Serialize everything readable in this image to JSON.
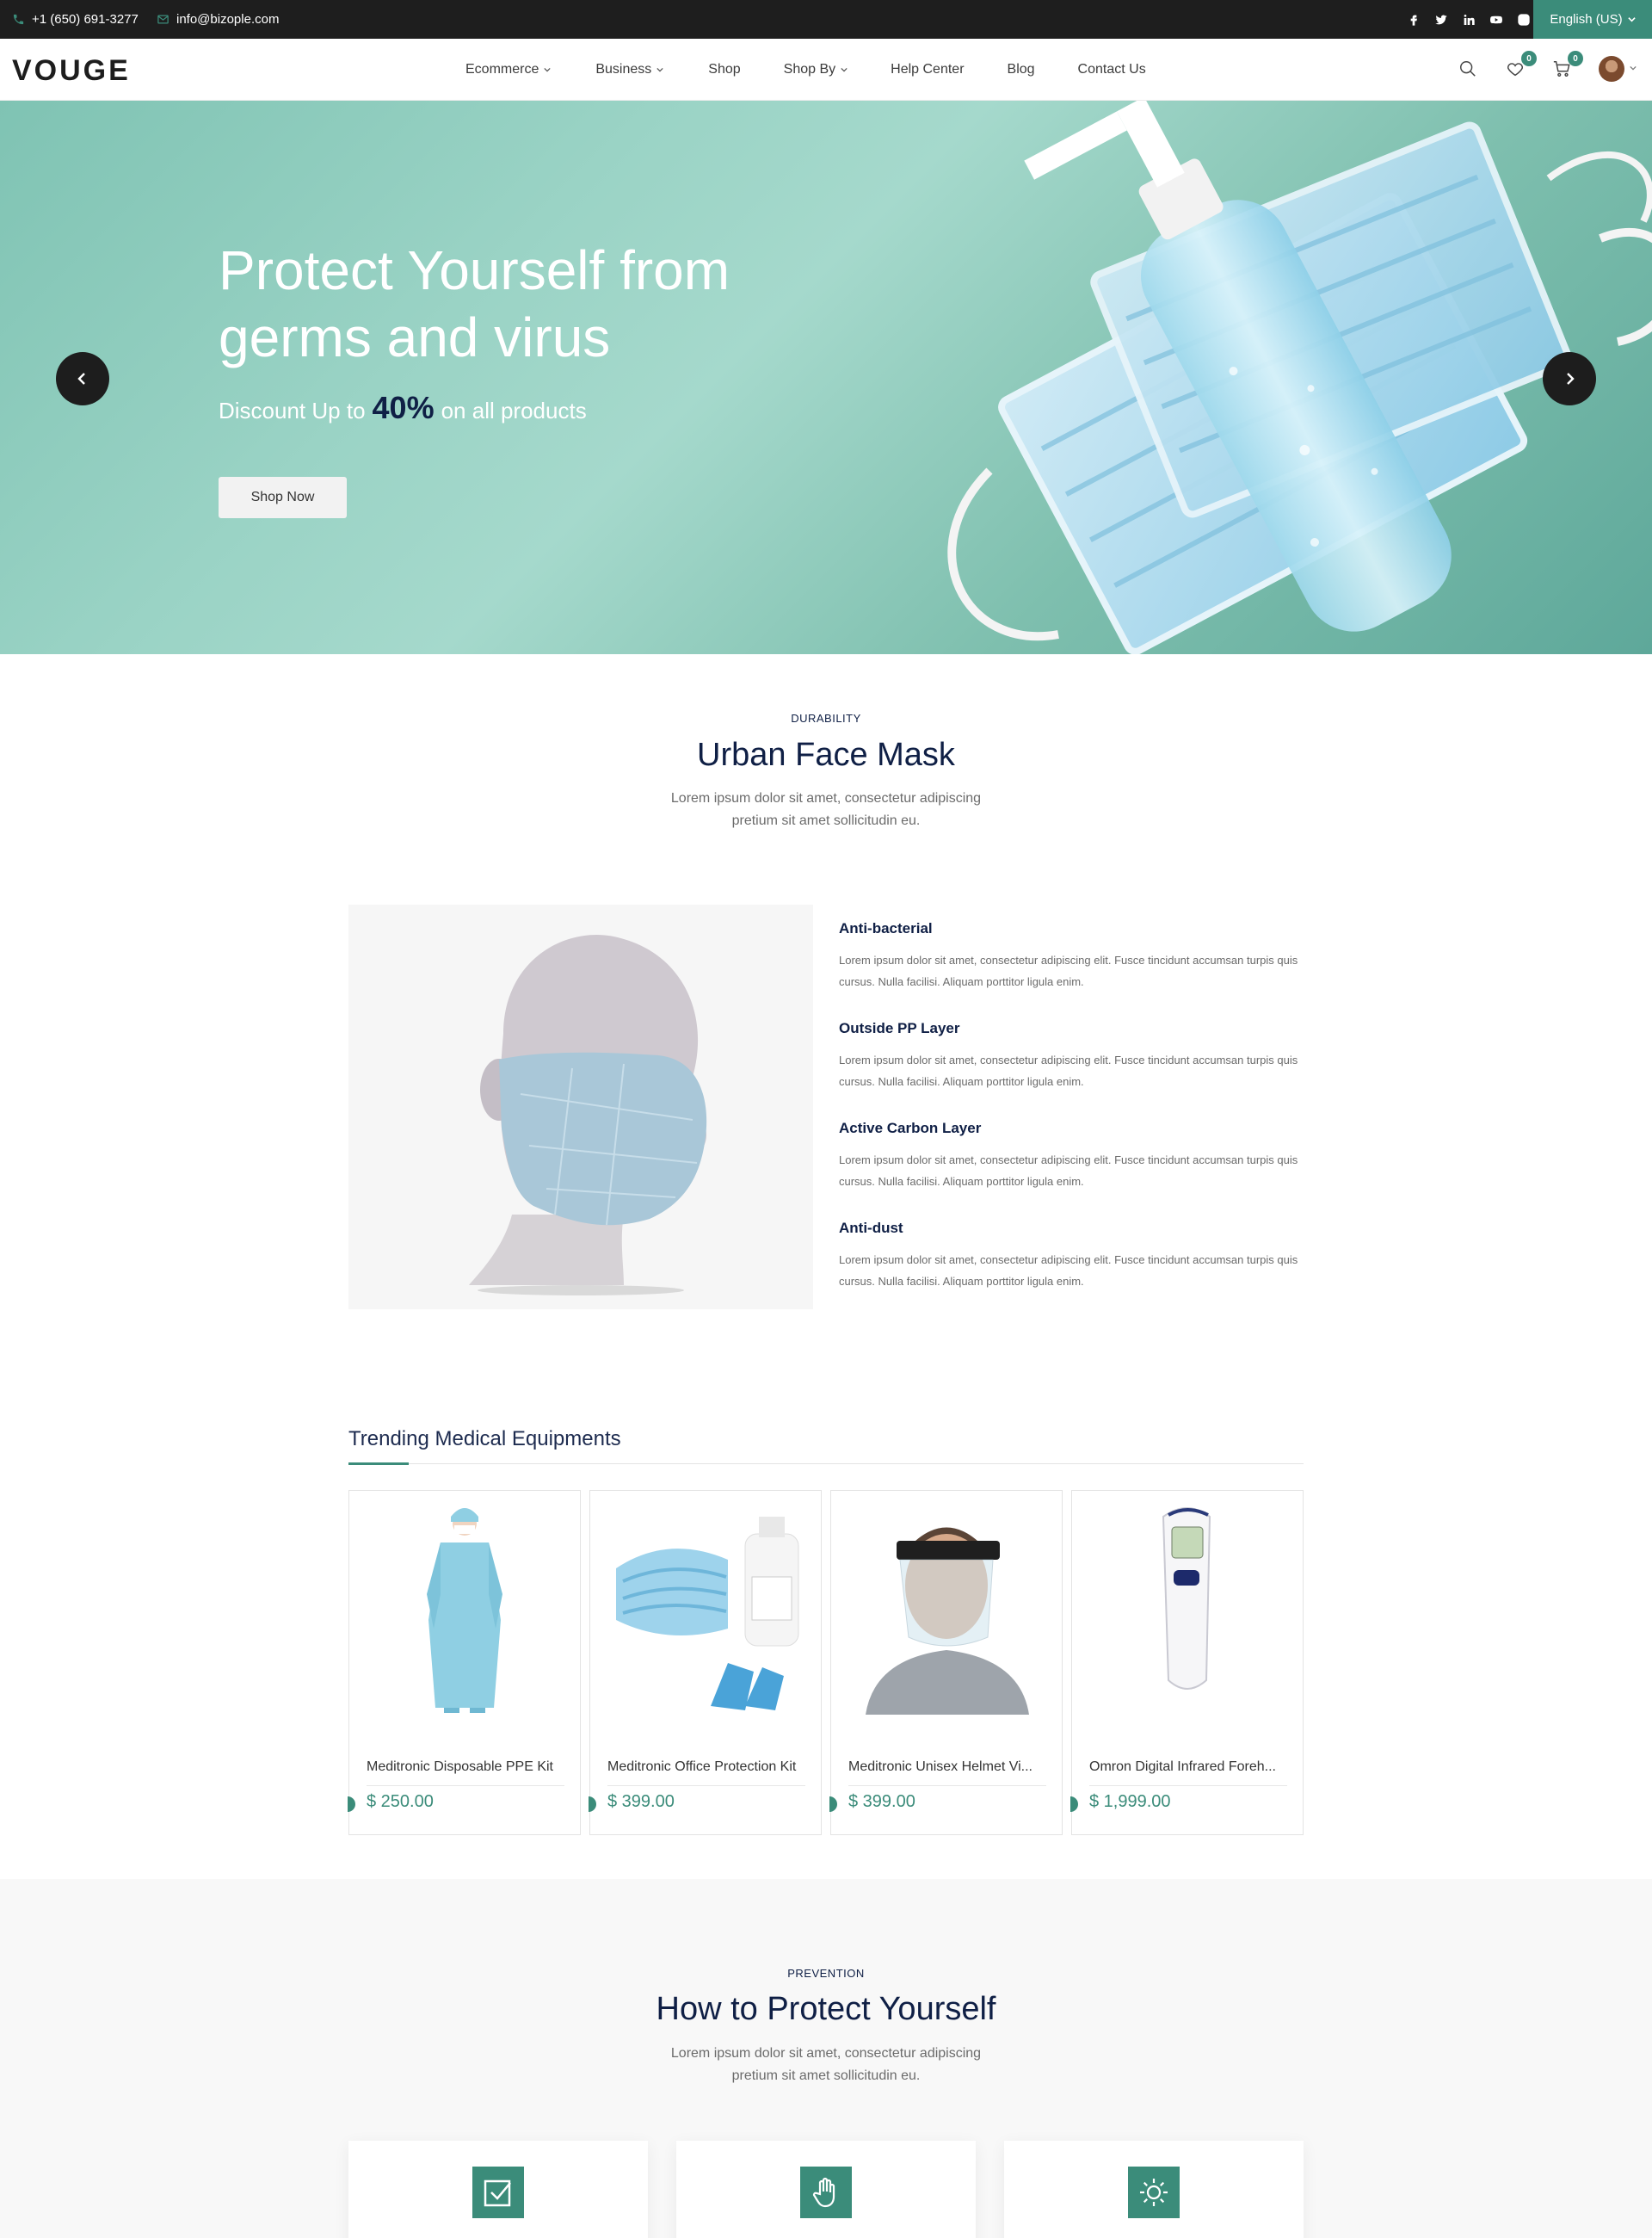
{
  "topbar": {
    "phone": "+1 (650) 691-3277",
    "email": "info@bizople.com",
    "socials": [
      "facebook-icon",
      "twitter-icon",
      "linkedin-icon",
      "youtube-icon",
      "instagram-icon"
    ],
    "language": "English (US)"
  },
  "header": {
    "logo": "VOUGE",
    "nav": [
      {
        "label": "Ecommerce",
        "dropdown": true
      },
      {
        "label": "Business",
        "dropdown": true
      },
      {
        "label": "Shop",
        "dropdown": false
      },
      {
        "label": "Shop By",
        "dropdown": true
      },
      {
        "label": "Help Center",
        "dropdown": false
      },
      {
        "label": "Blog",
        "dropdown": false
      },
      {
        "label": "Contact Us",
        "dropdown": false
      }
    ],
    "wishlist_count": "0",
    "cart_count": "0"
  },
  "hero": {
    "title": "Protect Yourself from germs and virus",
    "subtitle_pre": "Discount Up to",
    "subtitle_pct": "40%",
    "subtitle_post": "on all products",
    "cta": "Shop Now"
  },
  "mask_section": {
    "eyebrow": "DURABILITY",
    "title": "Urban Face Mask",
    "description": "Lorem ipsum dolor sit amet, consectetur adipiscing pretium sit amet sollicitudin eu.",
    "features": [
      {
        "title": "Anti-bacterial",
        "text": "Lorem ipsum dolor sit amet, consectetur adipiscing elit. Fusce tincidunt accumsan turpis quis cursus. Nulla facilisi. Aliquam porttitor ligula enim."
      },
      {
        "title": "Outside PP Layer",
        "text": "Lorem ipsum dolor sit amet, consectetur adipiscing elit. Fusce tincidunt accumsan turpis quis cursus. Nulla facilisi. Aliquam porttitor ligula enim."
      },
      {
        "title": "Active Carbon Layer",
        "text": "Lorem ipsum dolor sit amet, consectetur adipiscing elit. Fusce tincidunt accumsan turpis quis cursus. Nulla facilisi. Aliquam porttitor ligula enim."
      },
      {
        "title": "Anti-dust",
        "text": "Lorem ipsum dolor sit amet, consectetur adipiscing elit. Fusce tincidunt accumsan turpis quis cursus. Nulla facilisi. Aliquam porttitor ligula enim."
      }
    ]
  },
  "trending": {
    "title": "Trending Medical Equipments",
    "products": [
      {
        "name": "Meditronic Disposable PPE Kit",
        "price": "$ 250.00"
      },
      {
        "name": "Meditronic Office Protection Kit",
        "price": "$ 399.00"
      },
      {
        "name": "Meditronic Unisex Helmet Vi...",
        "price": "$ 399.00"
      },
      {
        "name": "Omron Digital Infrared Foreh...",
        "price": "$ 1,999.00"
      }
    ]
  },
  "prevention": {
    "eyebrow": "PREVENTION",
    "title": "How to Protect Yourself",
    "description": "Lorem ipsum dolor sit amet, consectetur adipiscing pretium sit amet sollicitudin eu.",
    "cards": [
      {
        "icon": "checkbox-icon"
      },
      {
        "icon": "hand-icon"
      },
      {
        "icon": "sun-icon"
      }
    ]
  },
  "colors": {
    "accent": "#3b8c7a",
    "navy": "#0f1f45",
    "topbar": "#1e1e1e"
  }
}
